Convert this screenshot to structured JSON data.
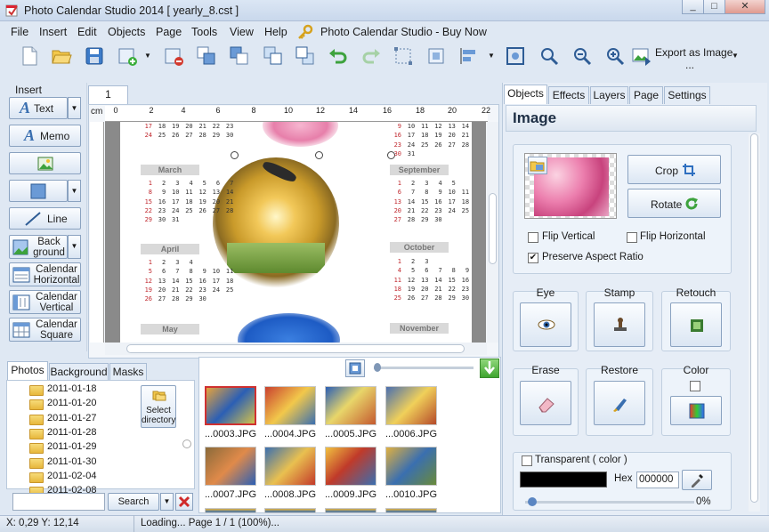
{
  "window": {
    "title": "Photo Calendar Studio 2014 [ yearly_8.cst ]",
    "controls": [
      "_",
      "□",
      "✕"
    ]
  },
  "menu": [
    "File",
    "Insert",
    "Edit",
    "Objects",
    "Page",
    "Tools",
    "View",
    "Help"
  ],
  "buy_now": "Photo Calendar Studio - Buy Now",
  "toolbar": {
    "export_label": "Export as Image",
    "export_more": "..."
  },
  "insert_panel": {
    "title": "Insert",
    "text": "Text",
    "memo": "Memo",
    "line": "Line",
    "background": "Back ground",
    "cal_horizontal": "Calendar Horizontal",
    "cal_vertical": "Calendar Vertical",
    "cal_square": "Calendar Square"
  },
  "page_tab": "1",
  "ruler": {
    "unit": "cm",
    "ticks": [
      "0",
      "2",
      "4",
      "6",
      "8",
      "10",
      "12",
      "14",
      "16",
      "18",
      "20",
      "22"
    ]
  },
  "calendar": {
    "left_months": [
      "March",
      "April",
      "May"
    ],
    "right_months": [
      "September",
      "October",
      "November"
    ],
    "top_rows_left": [
      "17 18 19 20 21 22 23",
      "24 25 26 27 28 29 30"
    ],
    "top_rows_right": [
      "9 10 11 12 13 14 15",
      "16 17 18 19 20 21 22",
      "23 24 25 26 27 28 29",
      "30 31"
    ],
    "march_rows": [
      "1 2 3 4 5 6 7",
      "8 9 10 11 12 13 14",
      "15 16 17 18 19 20 21",
      "22 23 24 25 26 27 28",
      "29 30 31"
    ],
    "april_rows": [
      "1 2 3 4",
      "5 6 7 8 9 10 11",
      "12 13 14 15 16 17 18",
      "19 20 21 22 23 24 25",
      "26 27 28 29 30"
    ],
    "sept_rows": [
      "1 2 3 4 5",
      "6 7 8 9 10 11 12",
      "13 14 15 16 17 18 19",
      "20 21 22 23 24 25 26",
      "27 28 29 30"
    ],
    "oct_rows": [
      "1 2 3",
      "4 5 6 7 8 9 10",
      "11 12 13 14 15 16 17",
      "18 19 20 21 22 23 24",
      "25 26 27 28 29 30 31"
    ]
  },
  "bottom_tabs": [
    "Photos",
    "Background",
    "Masks"
  ],
  "folders": [
    "2011-01-18",
    "2011-01-20",
    "2011-01-27",
    "2011-01-28",
    "2011-01-29",
    "2011-01-30",
    "2011-02-04",
    "2011-02-08"
  ],
  "select_directory": "Select directory",
  "search": {
    "button": "Search",
    "value": ""
  },
  "thumbnails": [
    "...0003.JPG",
    "...0004.JPG",
    "...0005.JPG",
    "...0006.JPG",
    "...0007.JPG",
    "...0008.JPG",
    "...0009.JPG",
    "...0010.JPG"
  ],
  "right_tabs": [
    "Objects",
    "Effects",
    "Layers",
    "Page",
    "Settings"
  ],
  "image_panel": {
    "header": "Image",
    "crop": "Crop",
    "rotate": "Rotate",
    "flip_vertical": "Flip Vertical",
    "flip_horizontal": "Flip Horizontal",
    "preserve_aspect": "Preserve Aspect Ratio",
    "eye": "Eye",
    "stamp": "Stamp",
    "retouch": "Retouch",
    "erase": "Erase",
    "restore": "Restore",
    "color": "Color",
    "transparent": "Transparent ( color )",
    "hex_label": "Hex",
    "hex_value": "000000",
    "percent": "0%"
  },
  "status": {
    "coords": "X: 0,29 Y: 12,14",
    "message": "Loading... Page 1 / 1 (100%)..."
  },
  "colors": {
    "accent": "#3a6fb0",
    "red_text": "#c0282e",
    "panel": "#e9f0f8"
  }
}
